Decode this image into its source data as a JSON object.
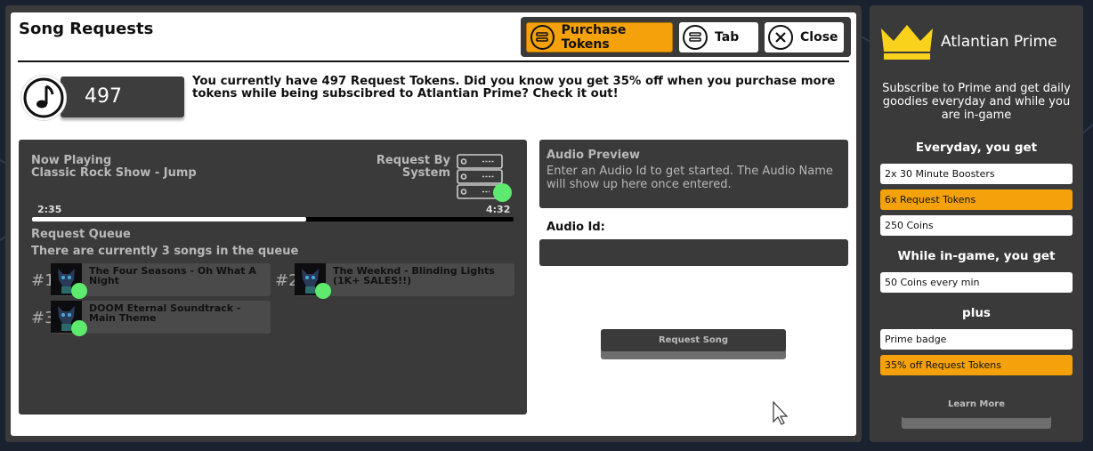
{
  "modal": {
    "title": "Song Requests",
    "toolbar": {
      "purchase_label": "Purchase Tokens",
      "tab_label": "Tab",
      "close_label": "Close"
    }
  },
  "tokens": {
    "count": "497",
    "message": "You currently have 497 Request Tokens. Did you know you get 35% off when you purchase more tokens while being subscibred to Atlantian Prime? Check it out!"
  },
  "now_playing": {
    "label": "Now Playing",
    "song": "Classic Rock Show - Jump",
    "request_by_label": "Request By",
    "request_by": "System",
    "elapsed": "2:35",
    "duration": "4:32",
    "progress_fraction": 0.57
  },
  "queue": {
    "heading": "Request Queue",
    "status": "There are currently 3 songs in the queue",
    "items": [
      {
        "num": "#1",
        "title": "The Four Seasons - Oh What A Night"
      },
      {
        "num": "#2",
        "title": "The Weeknd - Blinding Lights (1K+ SALES!!)"
      },
      {
        "num": "#3",
        "title": "DOOM Eternal Soundtrack - Main Theme"
      }
    ]
  },
  "audio_preview": {
    "heading": "Audio Preview",
    "hint": "Enter an Audio Id to get started. The Audio Name will show up here once entered.",
    "id_label": "Audio Id:",
    "id_value": "",
    "request_button": "Request Song"
  },
  "prime": {
    "title": "Atlantian Prime",
    "description": "Subscribe to Prime and get daily goodies everyday and while you are in-game",
    "everyday_heading": "Everyday, you get",
    "everyday_perks": [
      "2x 30 Minute Boosters",
      "6x Request Tokens",
      "250 Coins"
    ],
    "ingame_heading": "While in-game, you get",
    "ingame_perks": [
      "50 Coins every min"
    ],
    "plus_heading": "plus",
    "plus_perks": [
      "Prime badge",
      "35% off Request Tokens"
    ],
    "learn_more": "Learn More"
  },
  "colors": {
    "accent": "#f4a10b",
    "panel": "#3a3a3a",
    "online_dot": "#5dea6f"
  }
}
